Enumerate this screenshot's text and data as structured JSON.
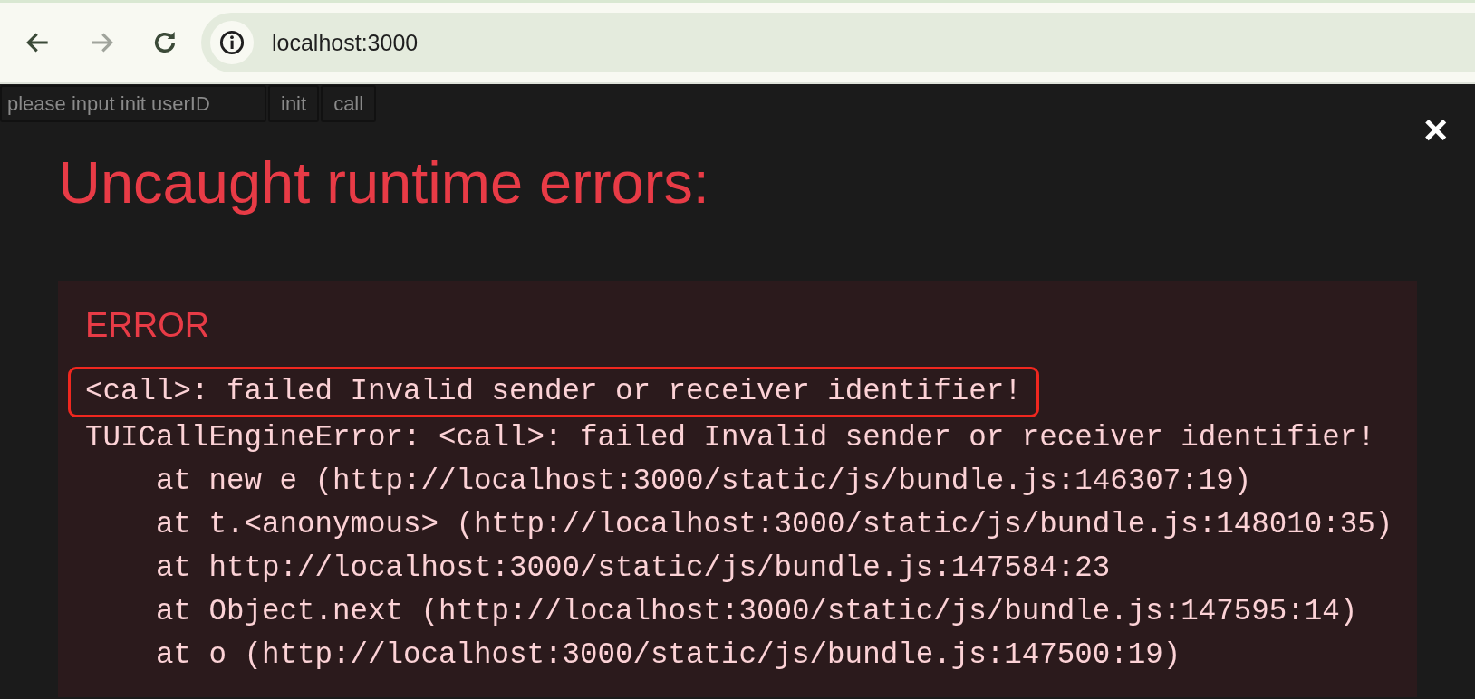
{
  "browser": {
    "address": "localhost:3000",
    "back_disabled": false,
    "forward_disabled": true
  },
  "controls": {
    "input": {
      "placeholder": "please input init userID"
    },
    "buttons": [
      "init",
      "call"
    ]
  },
  "overlay": {
    "close": "×",
    "title": "Uncaught runtime errors:",
    "error": {
      "label": "ERROR",
      "lines": [
        {
          "kind": "message",
          "text": "<call>: failed Invalid sender or receiver identifier!",
          "highlighted": true
        },
        {
          "kind": "message",
          "text": "TUICallEngineError: <call>: failed Invalid sender or receiver identifier!",
          "highlighted": false
        },
        {
          "kind": "frame",
          "text": "at new e (http://localhost:3000/static/js/bundle.js:146307:19)",
          "highlighted": false
        },
        {
          "kind": "frame",
          "text": "at t.<anonymous> (http://localhost:3000/static/js/bundle.js:148010:35)",
          "highlighted": false
        },
        {
          "kind": "frame",
          "text": "at http://localhost:3000/static/js/bundle.js:147584:23",
          "highlighted": false
        },
        {
          "kind": "frame",
          "text": "at Object.next (http://localhost:3000/static/js/bundle.js:147595:14)",
          "highlighted": false
        },
        {
          "kind": "frame",
          "text": "at o (http://localhost:3000/static/js/bundle.js:147500:19)",
          "highlighted": false
        }
      ]
    }
  }
}
